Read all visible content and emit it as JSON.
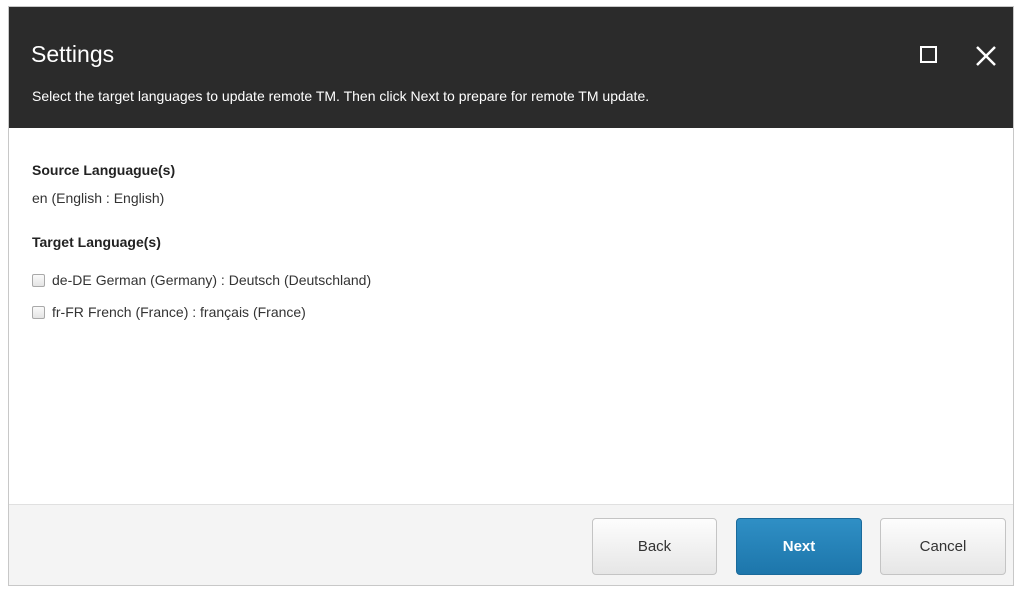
{
  "dialog": {
    "title": "Settings",
    "subtitle": "Select the target languages to update remote TM. Then click Next to prepare for remote TM update.",
    "window_controls": {
      "maximize_icon": "maximize-icon",
      "close_icon": "close-icon"
    }
  },
  "source": {
    "label": "Source Languague(s)",
    "value": "en (English : English)"
  },
  "target": {
    "label": "Target Language(s)",
    "languages": [
      {
        "code": "de-DE",
        "name": "German (Germany) : Deutsch (Deutschland)",
        "checked": false
      },
      {
        "code": "fr-FR",
        "name": "French (France) : français (France)",
        "checked": false
      }
    ]
  },
  "footer": {
    "back_label": "Back",
    "next_label": "Next",
    "cancel_label": "Cancel"
  },
  "colors": {
    "titlebar_bg": "#2b2b2b",
    "primary_button": "#2384bc",
    "footer_bg": "#f4f4f4"
  }
}
